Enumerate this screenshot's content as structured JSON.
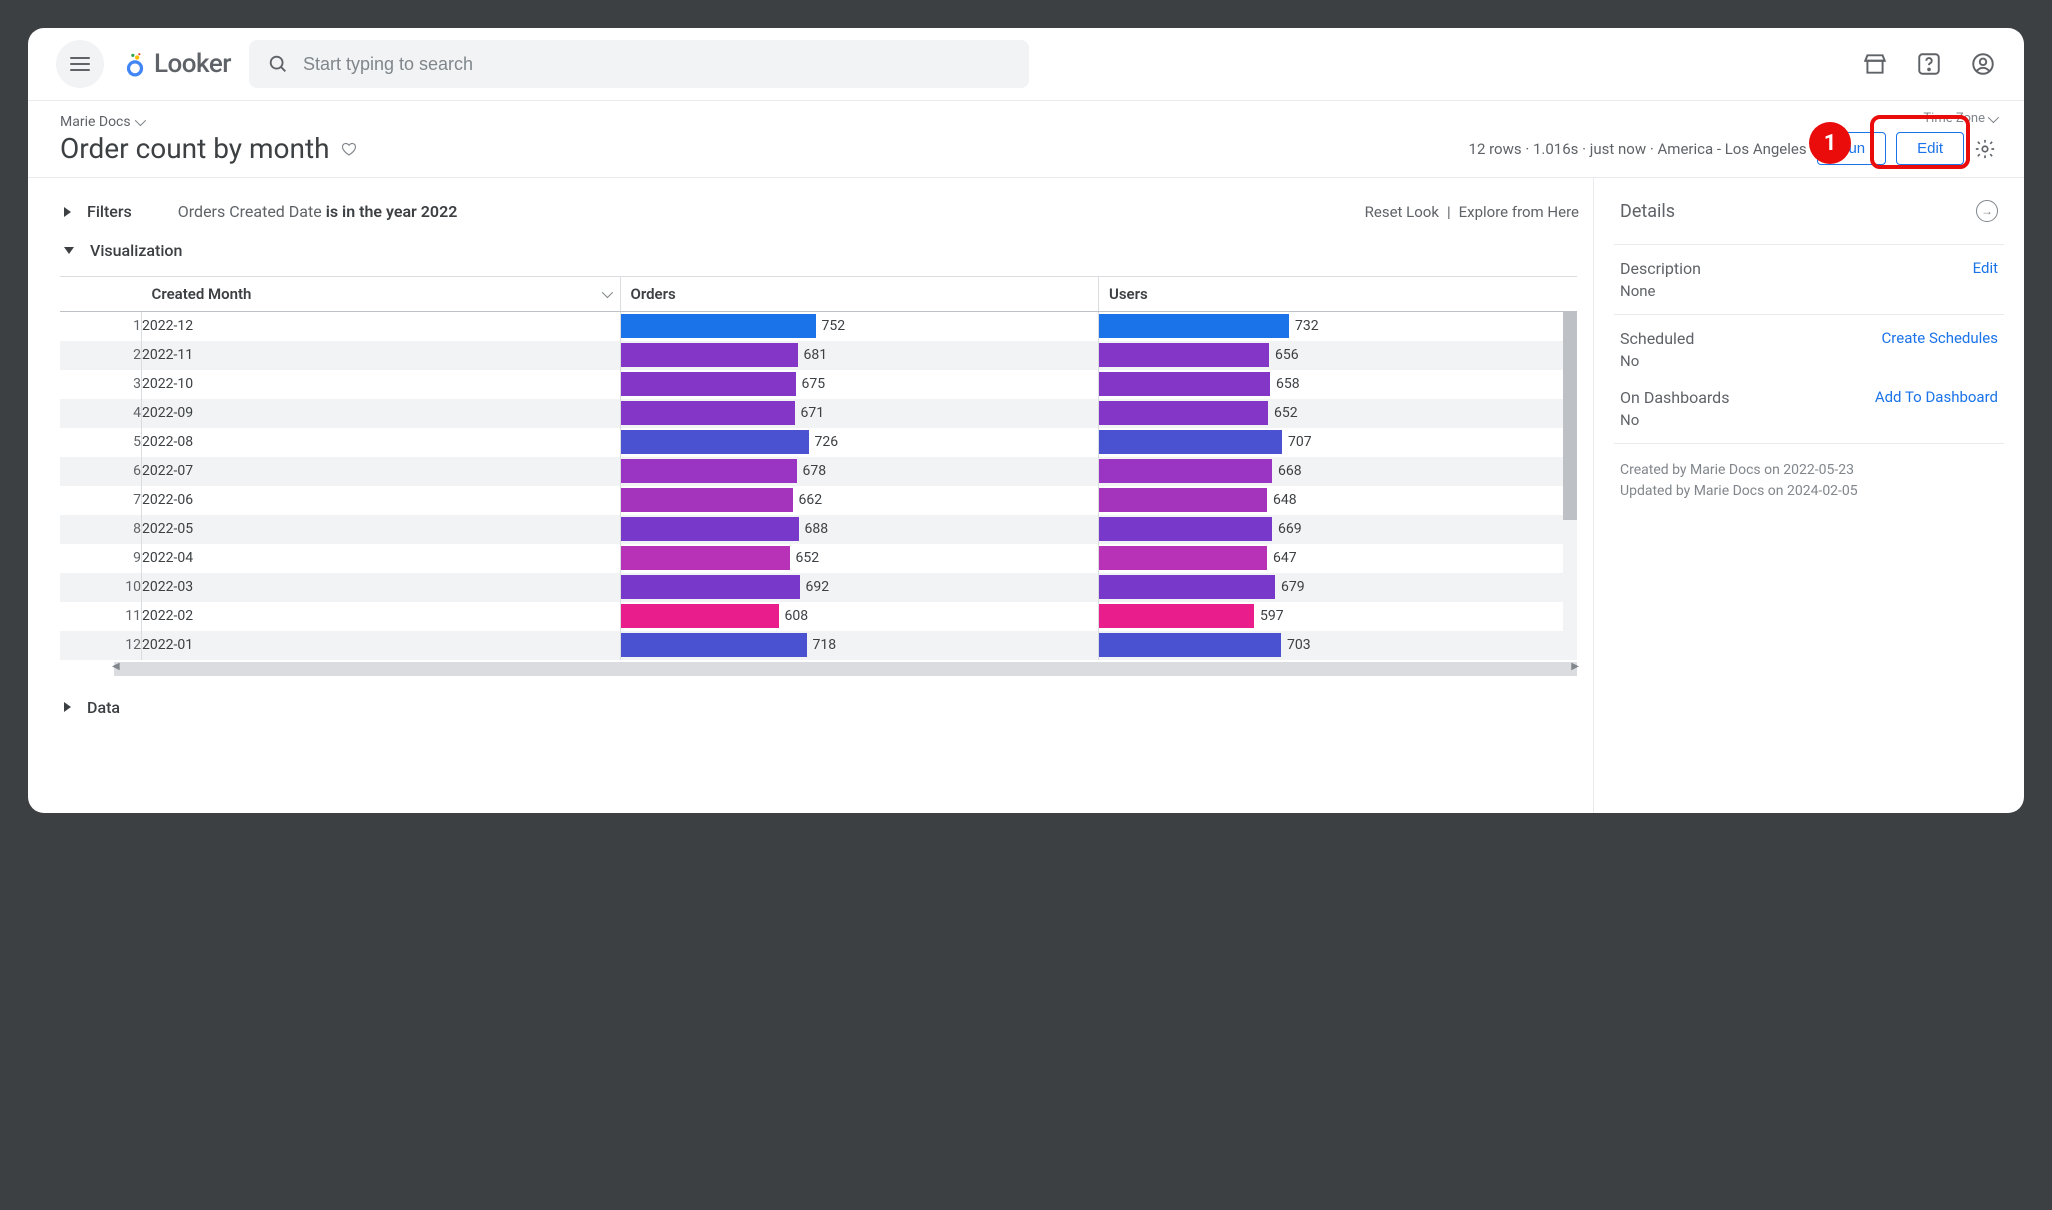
{
  "app": {
    "name": "Looker"
  },
  "search": {
    "placeholder": "Start typing to search"
  },
  "breadcrumb": "Marie Docs",
  "page_title": "Order count by month",
  "timezone_label": "Time Zone",
  "status": {
    "rows": "12 rows",
    "elapsed": "1.016s",
    "when": "just now",
    "tz": "America - Los Angeles"
  },
  "buttons": {
    "run": "Run",
    "edit": "Edit"
  },
  "annotation": {
    "number": "1"
  },
  "filters": {
    "section": "Filters",
    "field": "Orders Created Date",
    "condition": "is in the year 2022",
    "reset": "Reset Look",
    "explore": "Explore from Here"
  },
  "visualization_section": "Visualization",
  "data_section": "Data",
  "columns": {
    "month": "Created Month",
    "orders": "Orders",
    "users": "Users"
  },
  "chart_data": {
    "type": "bar",
    "max_value": 752,
    "colors": [
      "#1a73e8",
      "#8436c6",
      "#8436c6",
      "#8436c6",
      "#4a52d1",
      "#9935c2",
      "#a534bd",
      "#7839ca",
      "#b732b7",
      "#7839ca",
      "#e91e8c",
      "#4a52d1"
    ],
    "rows": [
      {
        "n": 1,
        "month": "2022-12",
        "orders": 752,
        "users": 732
      },
      {
        "n": 2,
        "month": "2022-11",
        "orders": 681,
        "users": 656
      },
      {
        "n": 3,
        "month": "2022-10",
        "orders": 675,
        "users": 658
      },
      {
        "n": 4,
        "month": "2022-09",
        "orders": 671,
        "users": 652
      },
      {
        "n": 5,
        "month": "2022-08",
        "orders": 726,
        "users": 707
      },
      {
        "n": 6,
        "month": "2022-07",
        "orders": 678,
        "users": 668
      },
      {
        "n": 7,
        "month": "2022-06",
        "orders": 662,
        "users": 648
      },
      {
        "n": 8,
        "month": "2022-05",
        "orders": 688,
        "users": 669
      },
      {
        "n": 9,
        "month": "2022-04",
        "orders": 652,
        "users": 647
      },
      {
        "n": 10,
        "month": "2022-03",
        "orders": 692,
        "users": 679
      },
      {
        "n": 11,
        "month": "2022-02",
        "orders": 608,
        "users": 597
      },
      {
        "n": 12,
        "month": "2022-01",
        "orders": 718,
        "users": 703
      }
    ]
  },
  "details": {
    "title": "Details",
    "description_label": "Description",
    "description_value": "None",
    "description_action": "Edit",
    "scheduled_label": "Scheduled",
    "scheduled_value": "No",
    "scheduled_action": "Create Schedules",
    "dashboards_label": "On Dashboards",
    "dashboards_value": "No",
    "dashboards_action": "Add To Dashboard",
    "created": "Created by Marie Docs on 2022-05-23",
    "updated": "Updated by Marie Docs on 2024-02-05"
  }
}
